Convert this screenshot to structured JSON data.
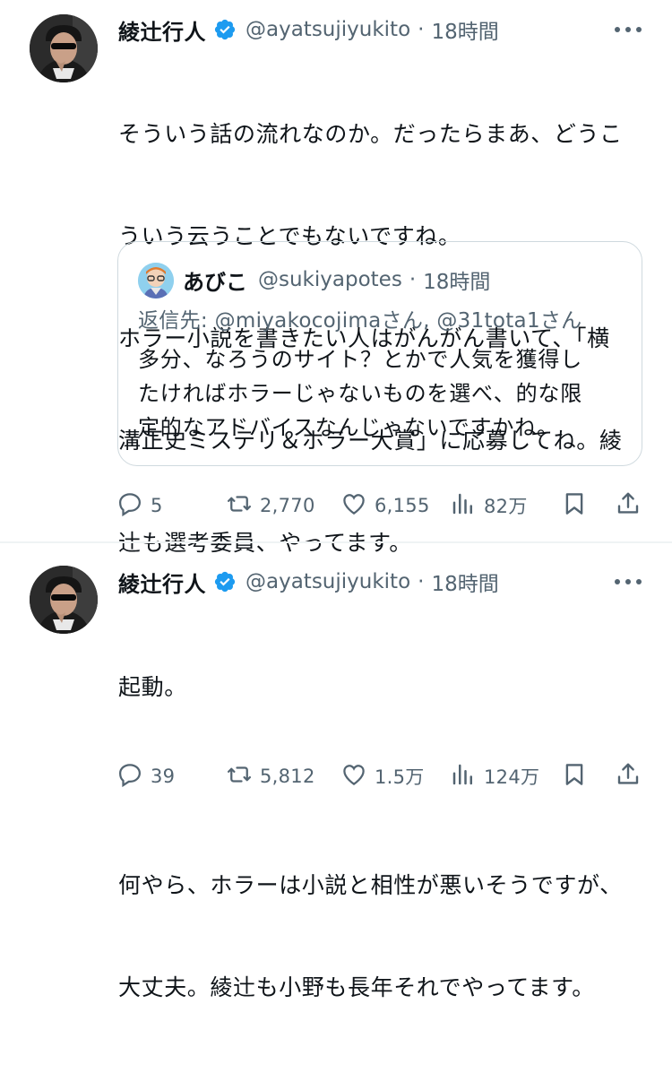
{
  "tweets": [
    {
      "author": "綾辻行人",
      "handle": "@ayatsujiyukito",
      "separator": "·",
      "time": "18時間",
      "text_lines": [
        "そういう話の流れなのか。だったらまあ、どうこ",
        "ういう云うことでもないですね。",
        "ホラー小説を書きたい人はがんがん書いて、「横",
        "溝正史ミステリ＆ホラー大賞」に応募してね。綾",
        "辻も選考委員、やってます。"
      ],
      "quote": {
        "author": "あびこ",
        "handle": "@sukiyapotes",
        "separator": "·",
        "time": "18時間",
        "reply_prefix": "返信先: ",
        "reply_mention_1": "@miyakocojimaさん",
        "reply_sep": ", ",
        "reply_mention_2": "@31tota1さん",
        "text_lines": [
          "多分、なろうのサイト？とかで人気を獲得し",
          "たければホラーじゃないものを選べ、的な限",
          "定的なアドバイスなんじゃないですかね。"
        ]
      },
      "actions": {
        "replies": "5",
        "retweets": "2,770",
        "likes": "6,155",
        "views": "82万"
      }
    },
    {
      "author": "綾辻行人",
      "handle": "@ayatsujiyukito",
      "separator": "·",
      "time": "18時間",
      "text_lines": [
        "起動。",
        "",
        "何やら、ホラーは小説と相性が悪いそうですが、",
        "大丈夫。綾辻も小野も長年それでやってます。"
      ],
      "actions": {
        "replies": "39",
        "retweets": "5,812",
        "likes": "1.5万",
        "views": "124万"
      }
    }
  ],
  "icons": {
    "verified": "verified-badge-icon",
    "more": "more-dots-icon",
    "reply": "reply-bubble-icon",
    "retweet": "retweet-icon",
    "like": "heart-icon",
    "views": "views-bar-chart-icon",
    "bookmark": "bookmark-icon",
    "share": "share-upload-icon"
  },
  "colors": {
    "text": "#0f1419",
    "secondary": "#536471",
    "verified": "#1d9bf0",
    "border": "#cfd9de"
  }
}
